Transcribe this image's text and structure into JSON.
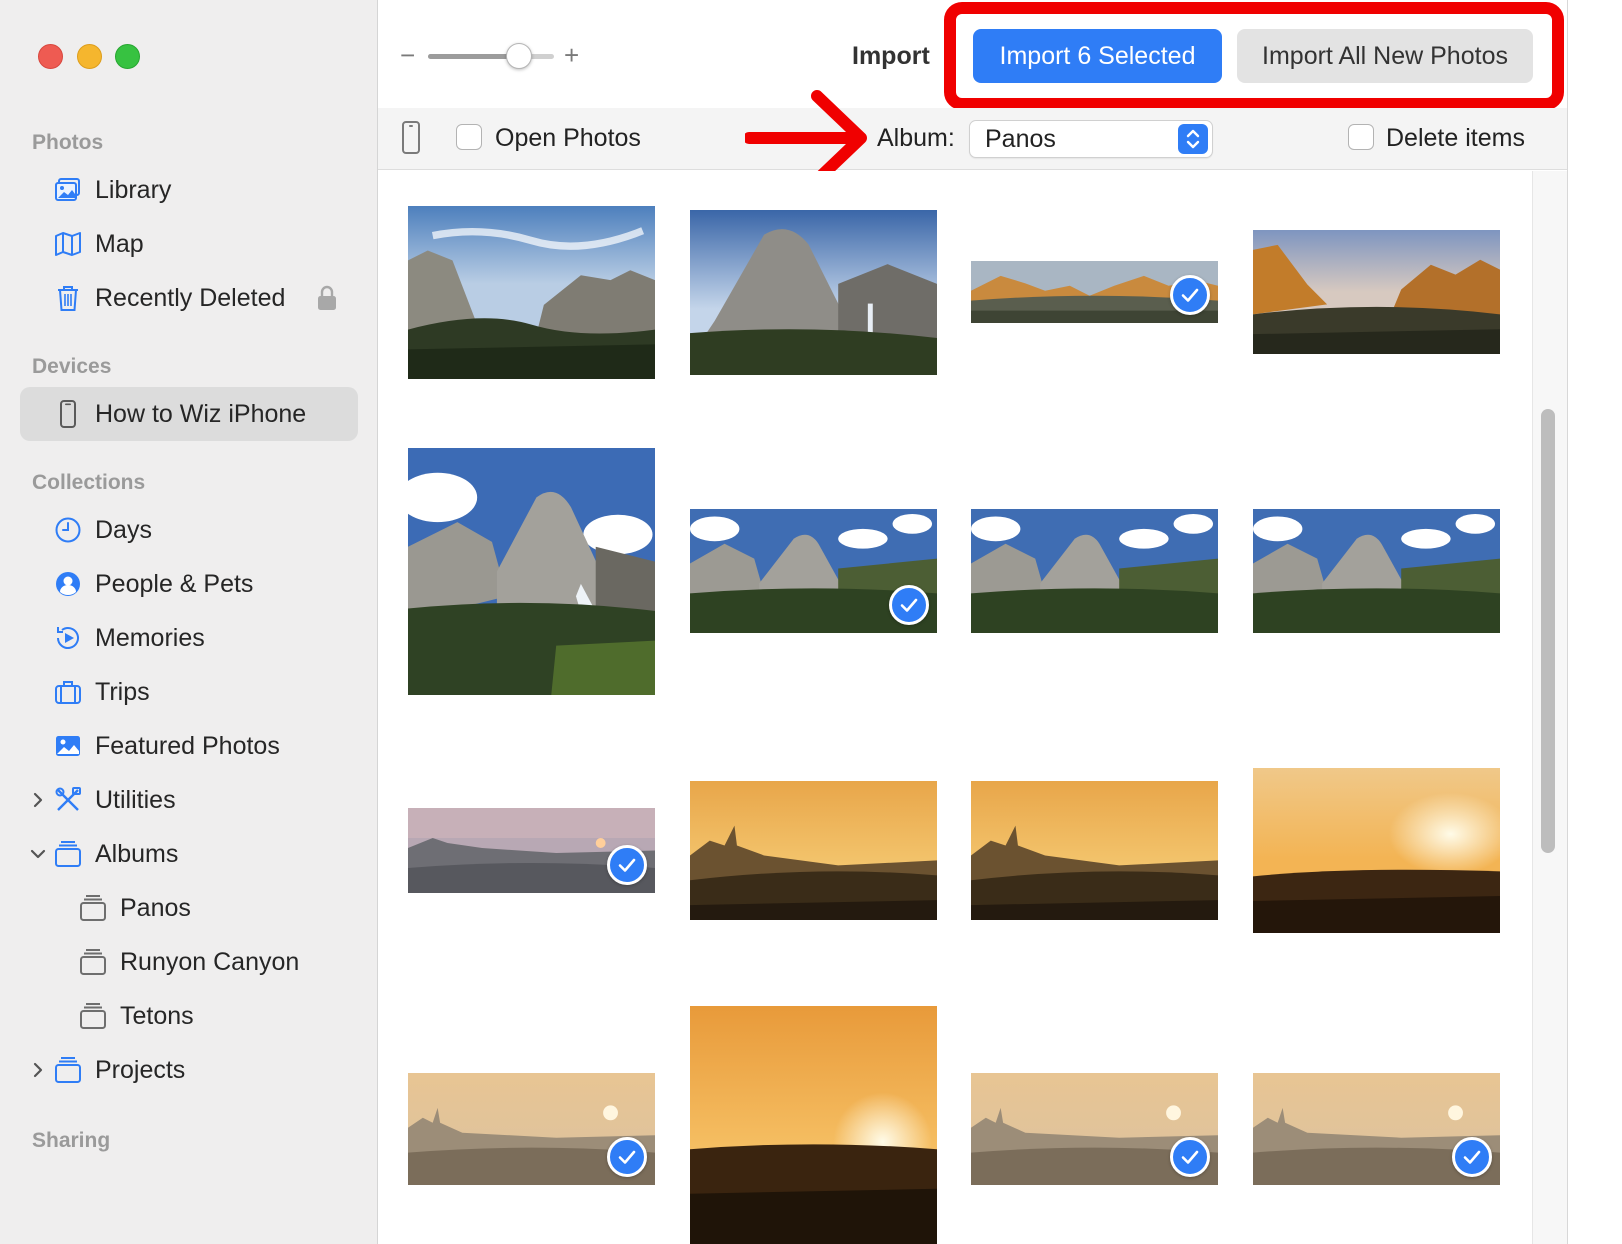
{
  "window": {
    "traffic_lights": [
      "close",
      "minimize",
      "zoom"
    ]
  },
  "sidebar": {
    "sections": {
      "photos": "Photos",
      "devices": "Devices",
      "collections": "Collections",
      "sharing": "Sharing"
    },
    "photos_items": [
      {
        "label": "Library",
        "icon": "library-icon"
      },
      {
        "label": "Map",
        "icon": "map-icon"
      },
      {
        "label": "Recently Deleted",
        "icon": "trash-icon",
        "locked": true
      }
    ],
    "device": {
      "label": "How to Wiz iPhone",
      "icon": "iphone-icon",
      "selected": true
    },
    "collections_items": [
      {
        "label": "Days",
        "icon": "clock-icon"
      },
      {
        "label": "People & Pets",
        "icon": "person-icon"
      },
      {
        "label": "Memories",
        "icon": "memories-icon"
      },
      {
        "label": "Trips",
        "icon": "suitcase-icon"
      },
      {
        "label": "Featured Photos",
        "icon": "featured-photos-icon"
      },
      {
        "label": "Utilities",
        "icon": "utilities-icon",
        "disclosure": "collapsed"
      },
      {
        "label": "Albums",
        "icon": "albums-icon",
        "disclosure": "expanded"
      },
      {
        "label": "Panos",
        "icon": "album-icon"
      },
      {
        "label": "Runyon Canyon",
        "icon": "album-icon"
      },
      {
        "label": "Tetons",
        "icon": "album-icon"
      },
      {
        "label": "Projects",
        "icon": "projects-icon",
        "disclosure": "collapsed"
      }
    ]
  },
  "toolbar": {
    "zoom_minus": "−",
    "zoom_plus": "+",
    "zoom_level": 0.72,
    "title": "Import",
    "import_selected_label": "Import 6 Selected",
    "import_all_label": "Import All New Photos"
  },
  "options": {
    "open_photos_label": "Open Photos",
    "open_photos_checked": false,
    "album_label": "Album:",
    "album_value": "Panos",
    "delete_items_label": "Delete items",
    "delete_items_checked": false
  },
  "annotations": {
    "highlight_color": "#f00000"
  },
  "accent_color": "#2f7df6",
  "photos": [
    {
      "scene": "yosemite-valley-cloudy",
      "selected": false
    },
    {
      "scene": "half-dome-falls",
      "selected": false
    },
    {
      "scene": "valley-panorama-sunset",
      "selected": true
    },
    {
      "scene": "valley-sunset-golden",
      "selected": false
    },
    {
      "scene": "nevada-fall-tall",
      "selected": false
    },
    {
      "scene": "nevada-fall-wide",
      "selected": true
    },
    {
      "scene": "nevada-fall-wide",
      "selected": false
    },
    {
      "scene": "nevada-fall-wide",
      "selected": false
    },
    {
      "scene": "hills-sunset-pink",
      "selected": true
    },
    {
      "scene": "hills-sunset-golden",
      "selected": false
    },
    {
      "scene": "hills-sunset-golden",
      "selected": false
    },
    {
      "scene": "hills-sunset-sun",
      "selected": false
    },
    {
      "scene": "hills-haze",
      "selected": true
    },
    {
      "scene": "hills-sun-bright",
      "selected": false
    },
    {
      "scene": "hills-haze",
      "selected": true
    },
    {
      "scene": "hills-haze",
      "selected": true
    }
  ]
}
